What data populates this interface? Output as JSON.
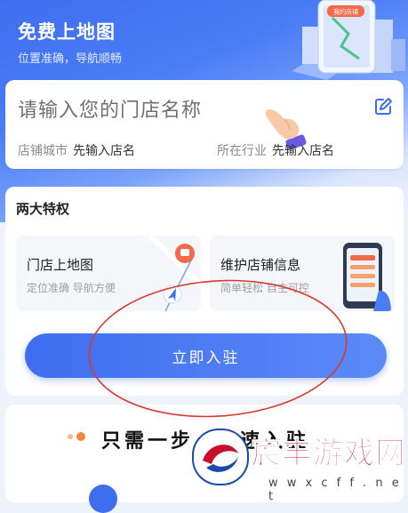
{
  "header": {
    "title": "免费上地图",
    "subtitle": "位置准确，导航顺畅",
    "badge": "我的店铺"
  },
  "store_form": {
    "name_placeholder": "请输入您的门店名称",
    "city_label": "店铺城市",
    "city_value": "先输入店名",
    "industry_label": "所在行业",
    "industry_value": "先输入店名"
  },
  "privileges": {
    "title": "两大特权",
    "items": [
      {
        "title": "门店上地图",
        "subtitle": "定位准确 导航方便"
      },
      {
        "title": "维护店铺信息",
        "subtitle": "简单轻松 自主可控"
      }
    ],
    "join_label": "立即入驻"
  },
  "steps": {
    "headline": "只需一步，极速入驻"
  },
  "watermark": {
    "name": "宸丰游戏网",
    "url": "w w x c f f . n e t"
  },
  "colors": {
    "primary": "#3e6df0",
    "annotation": "#d9382f",
    "accent_orange": "#f08a3c"
  }
}
